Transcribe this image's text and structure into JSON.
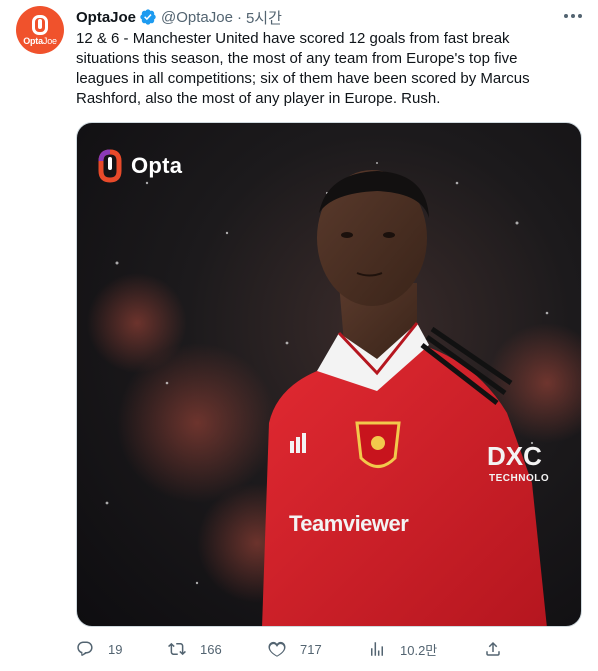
{
  "tweet": {
    "author": {
      "display_name": "OptaJoe",
      "handle": "@OptaJoe",
      "avatar_text": "Opta",
      "avatar_subtext": "Joe",
      "verified": true
    },
    "separator": "·",
    "timestamp": "5시간",
    "text": "12 & 6 - Manchester United have scored 12 goals from fast break situations this season, the most of any team from Europe's top five leagues in all competitions; six of them have been scored by Marcus Rashford, also the most of any player in Europe. Rush.",
    "media": {
      "logo_text": "Opta",
      "sponsor_text": "Teamviewer",
      "sleeve_text": "DXC",
      "sleeve_subtext": "TECHNOLO"
    },
    "actions": {
      "reply_count": "19",
      "retweet_count": "166",
      "like_count": "717",
      "views_count": "10.2만"
    }
  },
  "colors": {
    "accent": "#1d9bf0",
    "brand": "#f0522c",
    "muted_text": "#536471",
    "jersey_red": "#d7232e"
  },
  "icons": [
    "more-icon",
    "verified-badge-icon",
    "reply-icon",
    "retweet-icon",
    "like-icon",
    "views-icon",
    "share-icon"
  ]
}
